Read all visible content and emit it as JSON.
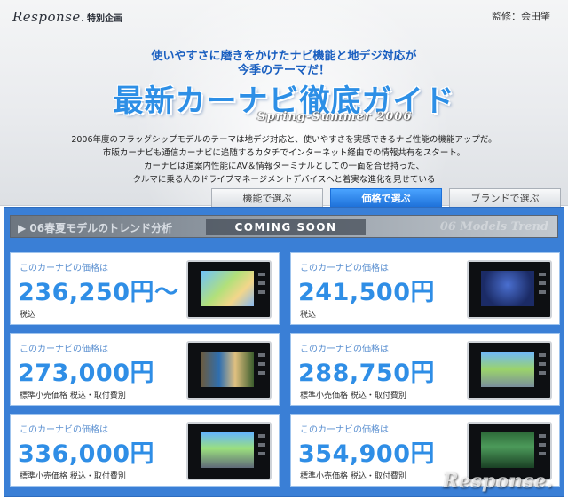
{
  "header": {
    "logo_text": "Response.",
    "logo_sub": "特別企画",
    "supervisor": "監修：会田肇",
    "catch_line1": "使いやすさに磨きをかけたナビ機能と地デジ対応が",
    "catch_line2": "今季のテーマだ！",
    "title": "最新カーナビ徹底ガイド",
    "season": "Spring-Summer 2006",
    "description": [
      "2006年度のフラッグシップモデルのテーマは地デジ対応と、使いやすさを実感できるナビ性能の機能アップだ。",
      "市販カーナビも通信カーナビに追随するカタチでインターネット経由での情報共有をスタート。",
      "カーナビは道案内性能にAV＆情報ターミナルとしての一面を合せ持った、",
      "クルマに乗る人のドライブマネージメントデバイスへと着実な進化を見せている"
    ]
  },
  "tabs": [
    {
      "label": "機能で選ぶ",
      "active": false
    },
    {
      "label": "価格で選ぶ",
      "active": true
    },
    {
      "label": "ブランドで選ぶ",
      "active": false
    }
  ],
  "trend": {
    "label": "06春夏モデルのトレンド分析",
    "coming_soon": "COMING SOON",
    "right_text": "06 Models Trend"
  },
  "cards": [
    {
      "lead": "このカーナビの価格は",
      "price": "236,250円〜",
      "note": "税込",
      "screen": "map"
    },
    {
      "lead": "このカーナビの価格は",
      "price": "241,500円",
      "note": "税込",
      "screen": "honda"
    },
    {
      "lead": "このカーナビの価格は",
      "price": "273,000円",
      "note": "標準小売価格 税込・取付費別",
      "screen": "photo"
    },
    {
      "lead": "このカーナビの価格は",
      "price": "288,750円",
      "note": "標準小売価格 税込・取付費別",
      "screen": "3d"
    },
    {
      "lead": "このカーナビの価格は",
      "price": "336,000円",
      "note": "標準小売価格 税込・取付費別",
      "screen": "road"
    },
    {
      "lead": "このカーナビの価格は",
      "price": "354,900円",
      "note": "標準小売価格 税込・取付費別",
      "screen": "menu"
    }
  ],
  "watermark": "Response.",
  "colors": {
    "accent": "#2f8ee6",
    "panel": "#3a7fd6",
    "tab_active": "#1c6fd8"
  }
}
